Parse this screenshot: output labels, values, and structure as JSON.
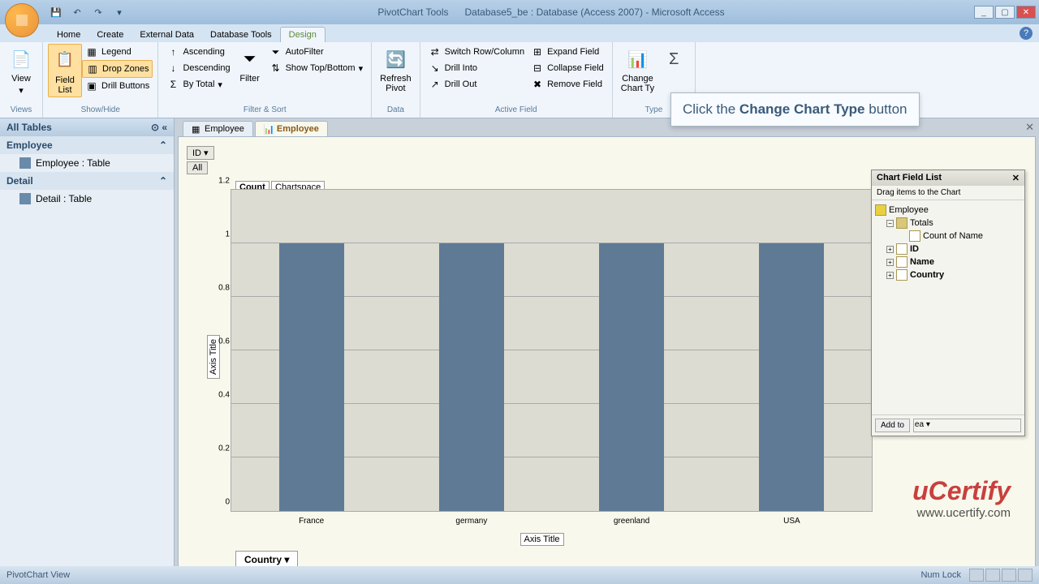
{
  "title": {
    "tools": "PivotChart Tools",
    "db": "Database5_be : Database (Access 2007) - Microsoft Access"
  },
  "ribbon_tabs": [
    "Home",
    "Create",
    "External Data",
    "Database Tools",
    "Design"
  ],
  "groups": {
    "views": {
      "view": "View",
      "label": "Views"
    },
    "showhide": {
      "field_list": "Field\nList",
      "legend": "Legend",
      "drop_zones": "Drop Zones",
      "drill_buttons": "Drill Buttons",
      "label": "Show/Hide"
    },
    "filtsort": {
      "filter": "Filter",
      "asc": "Ascending",
      "desc": "Descending",
      "bytotal": "By Total",
      "autofilter": "AutoFilter",
      "showtop": "Show Top/Bottom",
      "label": "Filter & Sort"
    },
    "data": {
      "refresh": "Refresh\nPivot",
      "label": "Data"
    },
    "active": {
      "switch": "Switch Row/Column",
      "into": "Drill Into",
      "out": "Drill Out",
      "expand": "Expand Field",
      "collapse": "Collapse Field",
      "remove": "Remove Field",
      "label": "Active Field"
    },
    "type": {
      "change": "Change\nChart Ty",
      "label": "Type"
    }
  },
  "callout": "Click the Change Chart Type button",
  "nav": {
    "header": "All Tables",
    "groups": [
      {
        "name": "Employee",
        "items": [
          "Employee : Table"
        ]
      },
      {
        "name": "Detail",
        "items": [
          "Detail : Table"
        ]
      }
    ]
  },
  "doc_tabs": [
    "Employee",
    "Employee"
  ],
  "chart": {
    "id_label": "ID ▾",
    "all_label": "All",
    "count_label": "Count",
    "chartspace_label": "Chartspace",
    "y_title": "Axis Title",
    "x_title": "Axis Title",
    "country_drop": "Country ▾"
  },
  "chart_data": {
    "type": "bar",
    "categories": [
      "France",
      "germany",
      "greenland",
      "USA"
    ],
    "values": [
      1,
      1,
      1,
      1
    ],
    "y_ticks": [
      0,
      0.2,
      0.4,
      0.6,
      0.8,
      1,
      1.2
    ],
    "ylim": [
      0,
      1.2
    ],
    "ylabel": "Axis Title",
    "xlabel": "Axis Title"
  },
  "field_list": {
    "title": "Chart Field List",
    "sub": "Drag items to the Chart",
    "root": "Employee",
    "totals": "Totals",
    "count_of": "Count of Name",
    "fields": [
      "ID",
      "Name",
      "Country"
    ],
    "add_to": "Add to",
    "area": "ea"
  },
  "status": {
    "left": "PivotChart View",
    "right": "Num Lock"
  },
  "watermark": {
    "logo": "uCertify",
    "url": "www.ucertify.com"
  }
}
